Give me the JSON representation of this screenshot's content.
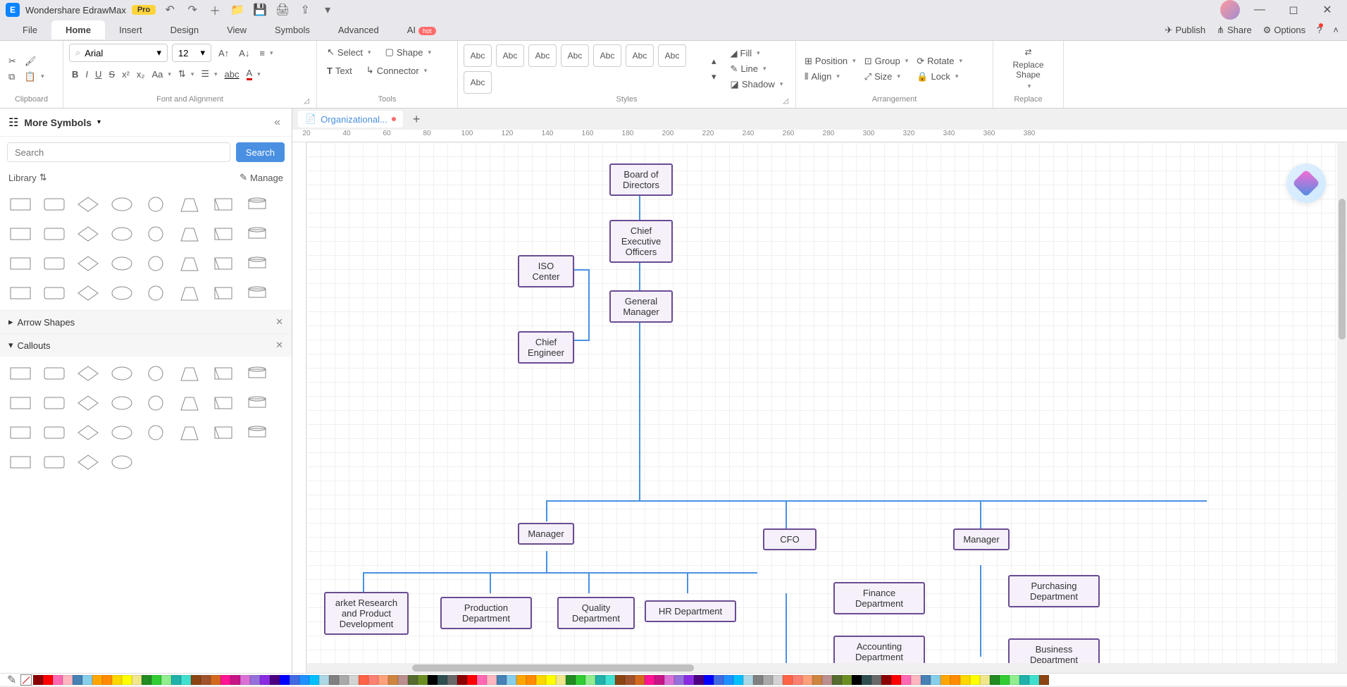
{
  "app": {
    "title": "Wondershare EdrawMax",
    "pro": "Pro"
  },
  "qat": {
    "undo": "↶",
    "redo": "↷"
  },
  "menu": {
    "tabs": [
      "File",
      "Home",
      "Insert",
      "Design",
      "View",
      "Symbols",
      "Advanced",
      "AI"
    ],
    "active": "Home",
    "hot": "hot",
    "right": {
      "publish": "Publish",
      "share": "Share",
      "options": "Options"
    }
  },
  "ribbon": {
    "clipboard": {
      "label": "Clipboard"
    },
    "font": {
      "label": "Font and Alignment",
      "family": "Arial",
      "size": "12"
    },
    "tools": {
      "label": "Tools",
      "select": "Select",
      "shape": "Shape",
      "text": "Text",
      "connector": "Connector"
    },
    "styles": {
      "label": "Styles",
      "swatch": "Abc",
      "fill": "Fill",
      "line": "Line",
      "shadow": "Shadow"
    },
    "arrange": {
      "label": "Arrangement",
      "position": "Position",
      "align": "Align",
      "group": "Group",
      "size": "Size",
      "rotate": "Rotate",
      "lock": "Lock"
    },
    "replace": {
      "label": "Replace",
      "btn": "Replace Shape"
    }
  },
  "panel": {
    "title": "More Symbols",
    "search": {
      "placeholder": "Search",
      "btn": "Search"
    },
    "library": {
      "label": "Library",
      "manage": "Manage"
    },
    "sections": {
      "arrow": "Arrow Shapes",
      "callouts": "Callouts"
    }
  },
  "doc": {
    "tab": "Organizational..."
  },
  "ruler": {
    "ticks": [
      20,
      40,
      60,
      80,
      100,
      120,
      140,
      160,
      180,
      200,
      220,
      240,
      260,
      280,
      300,
      320,
      340,
      360,
      380
    ]
  },
  "org": {
    "nodes": {
      "board": "Board of Directors",
      "ceo": "Chief Executive Officers",
      "iso": "ISO Center",
      "gm": "General Manager",
      "eng": "Chief Engineer",
      "mgr1": "Manager",
      "cfo": "CFO",
      "mgr2": "Manager",
      "market": "arket Research and Product Development",
      "prod": "Production Department",
      "quality": "Quality Department",
      "hr": "HR Department",
      "finance": "Finance Department",
      "acct": "Accounting Department",
      "purch": "Purchasing Department",
      "biz": "Business Department"
    }
  },
  "colors": [
    "#8b0000",
    "#ff0000",
    "#ff69b4",
    "#ffb6c1",
    "#4682b4",
    "#87ceeb",
    "#ffa500",
    "#ff8c00",
    "#ffd700",
    "#ffff00",
    "#f0e68c",
    "#228b22",
    "#32cd32",
    "#90ee90",
    "#20b2aa",
    "#40e0d0",
    "#8b4513",
    "#a0522d",
    "#d2691e",
    "#ff1493",
    "#c71585",
    "#da70d6",
    "#9370db",
    "#8a2be2",
    "#4b0082",
    "#0000ff",
    "#4169e1",
    "#1e90ff",
    "#00bfff",
    "#add8e6",
    "#808080",
    "#a9a9a9",
    "#d3d3d3",
    "#ff6347",
    "#fa8072",
    "#ffa07a",
    "#cd853f",
    "#bc8f8f",
    "#556b2f",
    "#6b8e23",
    "#000000",
    "#2f4f4f",
    "#696969"
  ]
}
